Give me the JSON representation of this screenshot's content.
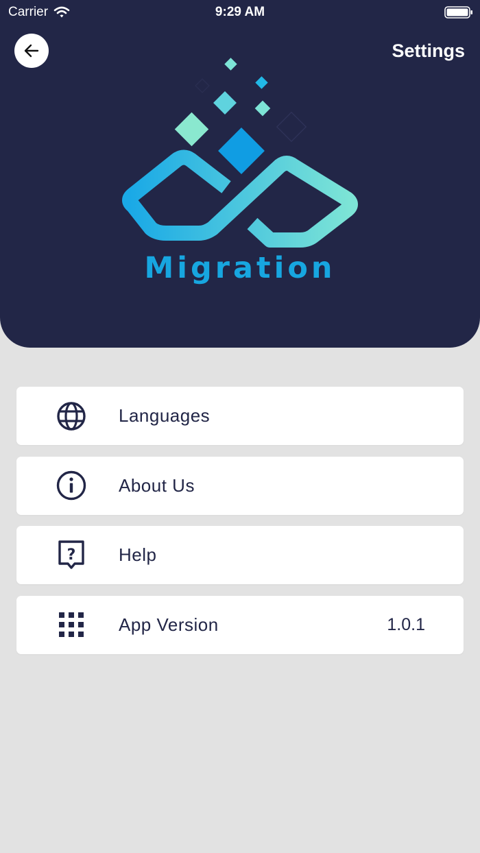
{
  "status_bar": {
    "carrier": "Carrier",
    "time": "9:29 AM"
  },
  "header": {
    "title": "Settings",
    "logo_text": "Migration"
  },
  "menu": {
    "items": [
      {
        "label": "Languages",
        "icon": "globe-icon"
      },
      {
        "label": "About Us",
        "icon": "info-icon"
      },
      {
        "label": "Help",
        "icon": "help-icon"
      },
      {
        "label": "App Version",
        "icon": "grid-icon",
        "value": "1.0.1"
      }
    ]
  },
  "colors": {
    "header_bg": "#222647",
    "page_bg": "#e2e2e2",
    "accent_blue": "#17a6e0",
    "accent_teal": "#7de4d6"
  }
}
